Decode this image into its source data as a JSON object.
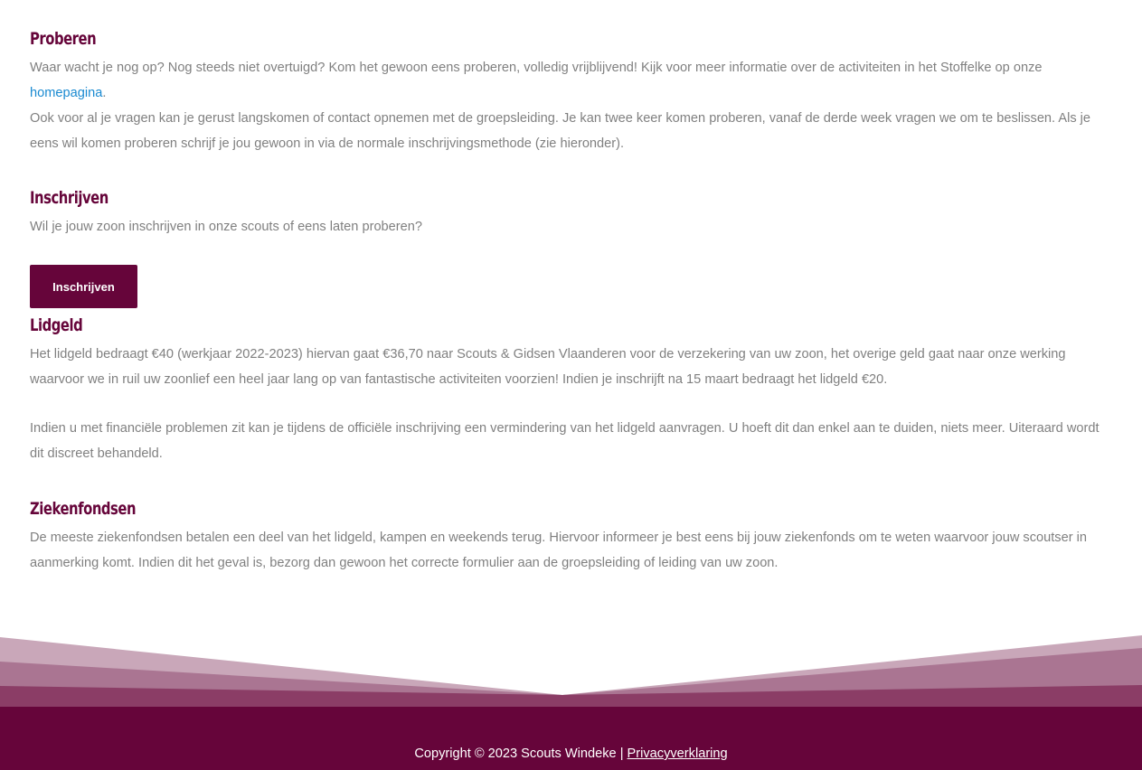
{
  "proberen": {
    "heading": "Proberen",
    "p1_before_link": "Waar wacht je nog op? Nog steeds niet overtuigd? Kom het gewoon eens proberen, volledig vrijblijvend! Kijk voor meer informatie over de activiteiten in het Stoffelke op onze ",
    "link": "homepagina",
    "p1_after_link": ".",
    "p2": "Ook voor al je vragen kan je gerust langskomen of contact opnemen met de groepsleiding. Je kan twee keer komen proberen, vanaf de derde week vragen we om te beslissen. Als je eens wil komen proberen schrijf je jou gewoon in via de normale inschrijvingsmethode (zie hieronder)."
  },
  "inschrijven": {
    "heading": "Inschrijven",
    "text": "Wil je jouw zoon inschrijven in onze scouts of eens laten proberen?",
    "button_label": "Inschrijven"
  },
  "lidgeld": {
    "heading": "Lidgeld",
    "p1": "Het lidgeld bedraagt €40 (werkjaar 2022-2023) hiervan gaat €36,70 naar Scouts & Gidsen Vlaanderen voor de verzekering van uw zoon, het overige geld gaat naar onze werking waarvoor we in ruil uw zoonlief een heel jaar lang op van fantastische activiteiten voorzien! Indien je inschrijft na 15 maart bedraagt het lidgeld €20.",
    "p2": "Indien u met financiële problemen zit kan je tijdens de officiële inschrijving een vermindering van het lidgeld aanvragen. U hoeft dit dan enkel aan te duiden, niets meer. Uiteraard wordt dit discreet behandeld."
  },
  "ziekenfondsen": {
    "heading": "Ziekenfondsen",
    "text": "De meeste ziekenfondsen betalen een deel van het lidgeld, kampen en weekends terug. Hiervoor informeer je best eens bij jouw ziekenfonds om te weten waarvoor jouw scoutser in aanmerking komt. Indien dit het geval is, bezorg dan gewoon het correcte formulier aan de groepsleiding of leiding van uw zoon."
  },
  "footer": {
    "copyright": "Copyright © 2023 Scouts Windeke",
    "separator": " | ",
    "privacy_link": "Privacyverklaring"
  },
  "colors": {
    "brand": "#66053a",
    "text": "#808080",
    "link": "#1a8ad1"
  }
}
